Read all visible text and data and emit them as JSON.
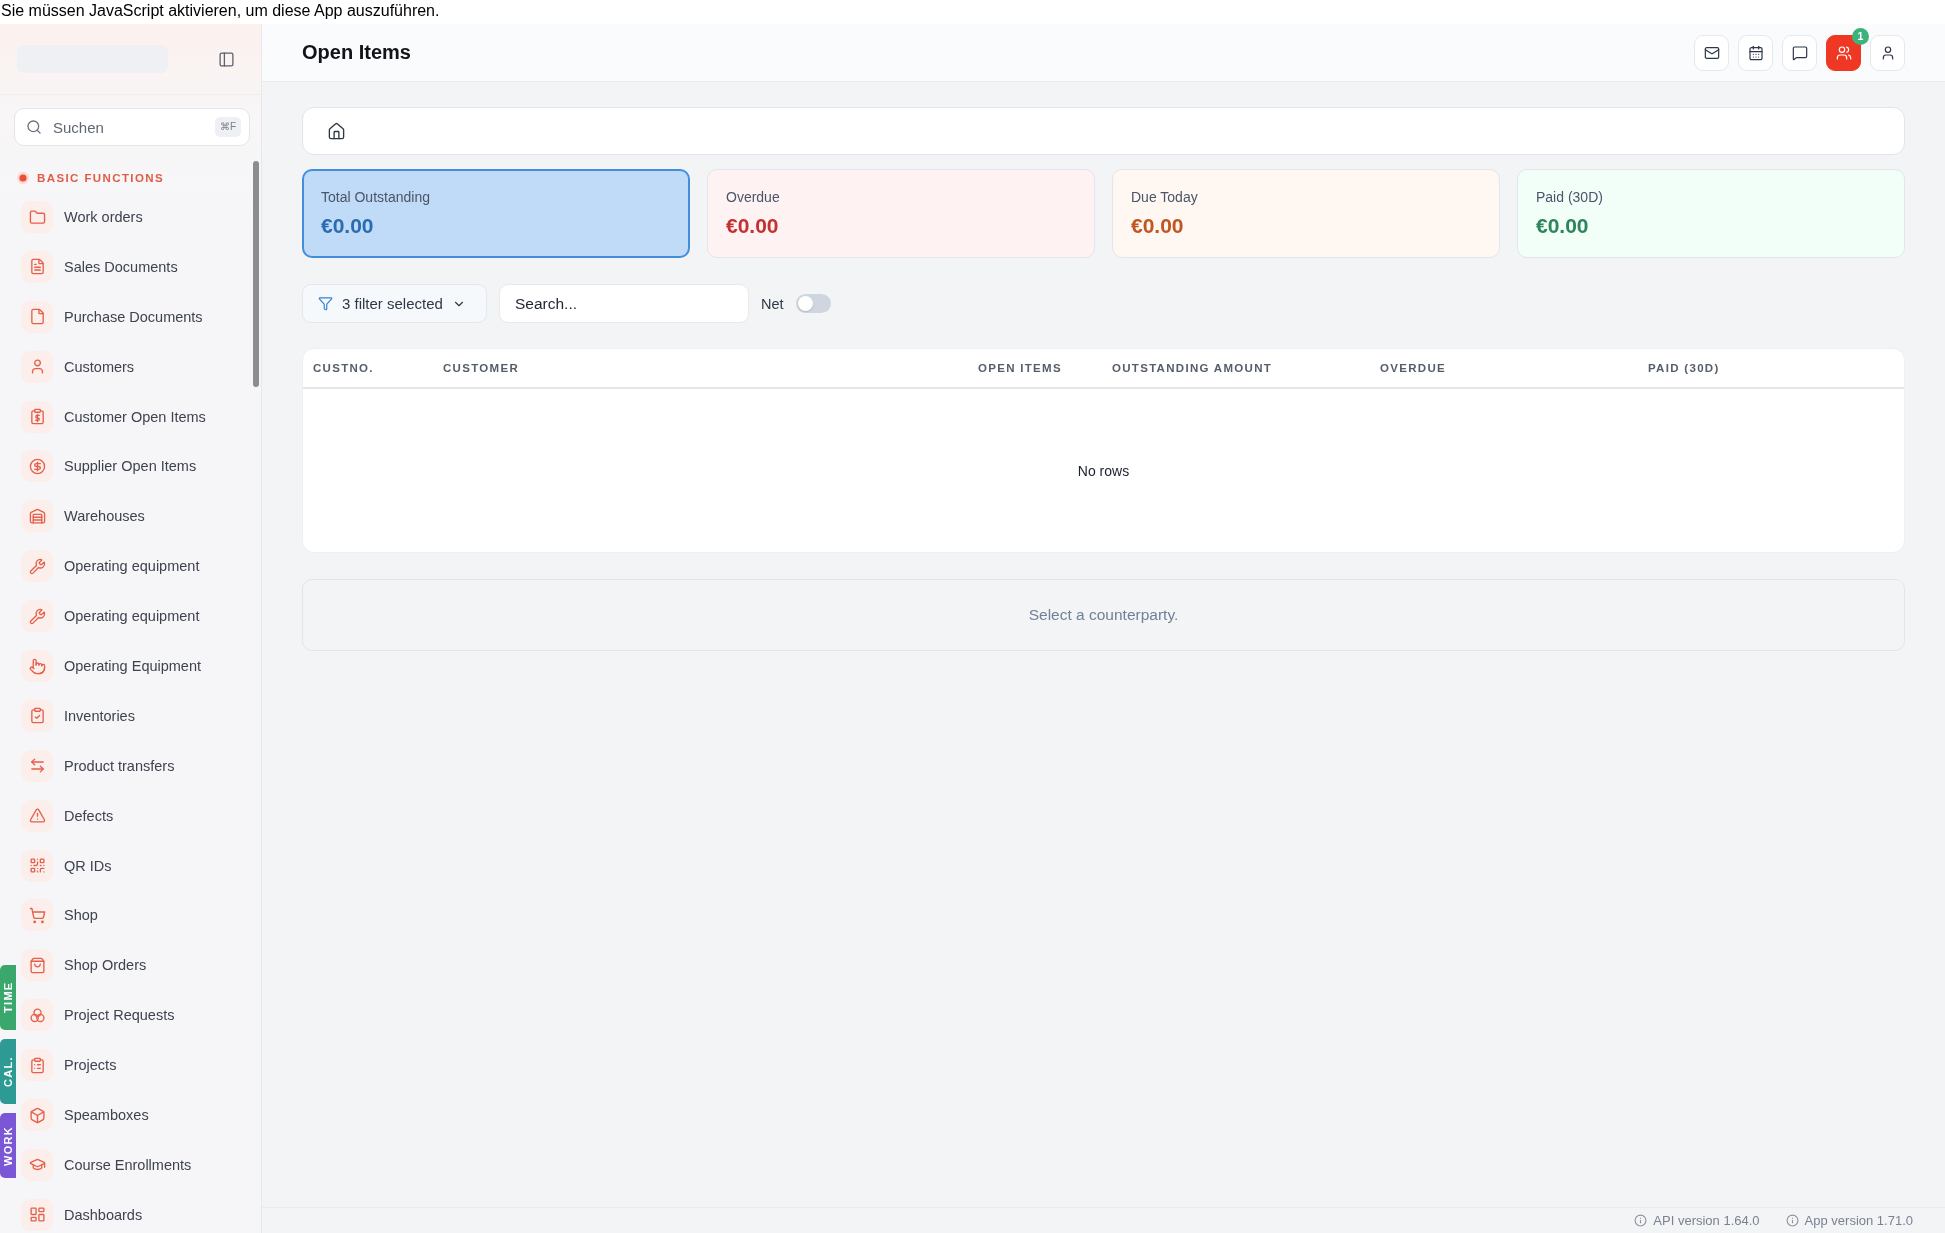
{
  "notice": "Sie müssen JavaScript aktivieren, um diese App auszuführen.",
  "sidebar": {
    "search": {
      "placeholder": "Suchen",
      "shortcut": "⌘F"
    },
    "section": "BASIC FUNCTIONS",
    "items": [
      {
        "label": "Work orders",
        "selected": false
      },
      {
        "label": "Sales Documents",
        "selected": false
      },
      {
        "label": "Purchase Documents",
        "selected": false
      },
      {
        "label": "Customers",
        "selected": false
      },
      {
        "label": "Customer Open Items",
        "selected": false
      },
      {
        "label": "Supplier Open Items",
        "selected": false
      },
      {
        "label": "Warehouses",
        "selected": false
      },
      {
        "label": "Operating equipment",
        "selected": false
      },
      {
        "label": "Operating equipment",
        "selected": false
      },
      {
        "label": "Operating Equipment",
        "selected": false
      },
      {
        "label": "Inventories",
        "selected": false
      },
      {
        "label": "Product transfers",
        "selected": false
      },
      {
        "label": "Defects",
        "selected": false
      },
      {
        "label": "QR IDs",
        "selected": false
      },
      {
        "label": "Shop",
        "selected": false
      },
      {
        "label": "Shop Orders",
        "selected": false
      },
      {
        "label": "Project Requests",
        "selected": false
      },
      {
        "label": "Projects",
        "selected": false
      },
      {
        "label": "Speamboxes",
        "selected": false
      },
      {
        "label": "Course Enrollments",
        "selected": false
      },
      {
        "label": "Dashboards",
        "selected": false
      }
    ],
    "side_tabs": [
      {
        "label": "TIME",
        "color": "#3aa76d"
      },
      {
        "label": "CAL.",
        "color": "#2d9a94"
      },
      {
        "label": "WORK",
        "color": "#7b57d6"
      }
    ]
  },
  "header": {
    "title": "Open Items",
    "actions": [
      {
        "active": false
      },
      {
        "active": false
      },
      {
        "active": false
      },
      {
        "active": true,
        "badge": "1"
      },
      {
        "active": false
      }
    ]
  },
  "cards": [
    {
      "label": "Total Outstanding",
      "amount": "€0.00",
      "color": "#2b6cb0",
      "selected": true
    },
    {
      "label": "Overdue",
      "amount": "€0.00",
      "color": "#c53030",
      "selected": false
    },
    {
      "label": "Due Today",
      "amount": "€0.00",
      "color": "#c05621",
      "selected": false
    },
    {
      "label": "Paid (30D)",
      "amount": "€0.00",
      "color": "#2f855a",
      "selected": false
    }
  ],
  "filters": {
    "filter_button": "3 filter selected",
    "search": {
      "placeholder": "Search..."
    },
    "net_toggle": {
      "label": "Net",
      "on": false
    }
  },
  "table": {
    "columns": [
      "CUSTNO.",
      "CUSTOMER",
      "OPEN ITEMS",
      "OUTSTANDING AMOUNT",
      "OVERDUE",
      "PAID (30D)"
    ],
    "empty_text": "No rows"
  },
  "detail_hint": "Select a counterparty.",
  "footer": [
    "API version 1.64.0",
    "App version 1.71.0"
  ]
}
